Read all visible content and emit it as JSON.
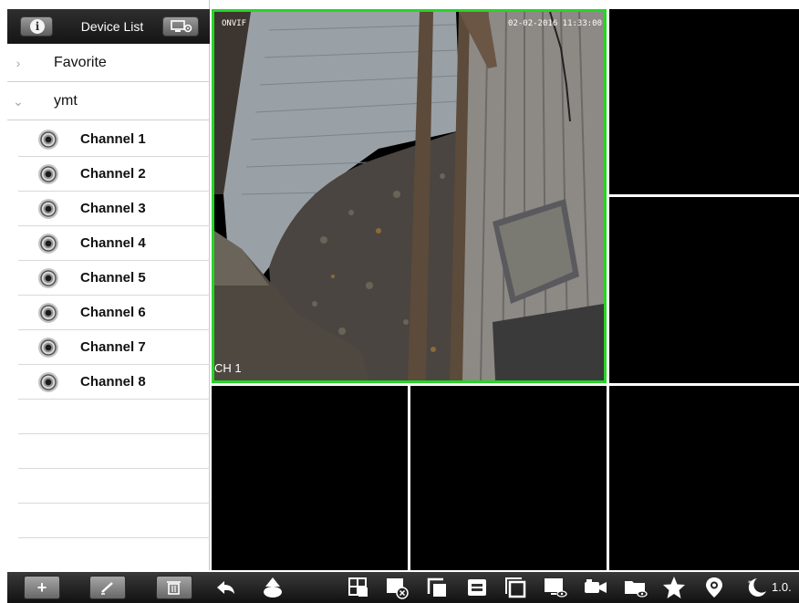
{
  "sidebar": {
    "title": "Device List",
    "info_icon": "info-icon",
    "settings_icon": "device-settings-icon",
    "groups": [
      {
        "label": "Favorite",
        "chevron": "›"
      },
      {
        "label": "ymt",
        "chevron": "⌄"
      }
    ],
    "channels": [
      {
        "label": "Channel 1"
      },
      {
        "label": "Channel 2"
      },
      {
        "label": "Channel 3"
      },
      {
        "label": "Channel 4"
      },
      {
        "label": "Channel 5"
      },
      {
        "label": "Channel 6"
      },
      {
        "label": "Channel 7"
      },
      {
        "label": "Channel 8"
      }
    ]
  },
  "video": {
    "active_channel_label": "CH 1",
    "osd_name": "ONVIF",
    "osd_timestamp": "02-02-2016 11:33:00",
    "active_border_color": "#27d427"
  },
  "toolbar": {
    "add_label": "+",
    "version": "1.0."
  }
}
